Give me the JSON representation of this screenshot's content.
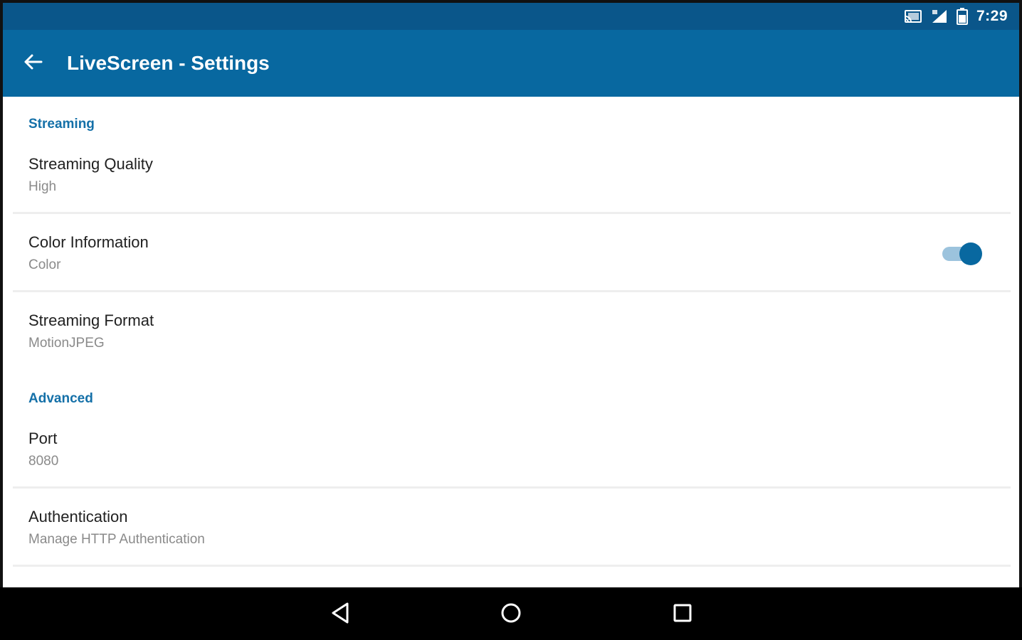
{
  "status_bar": {
    "time": "7:29",
    "icons": [
      "cast-icon",
      "signal-icon",
      "battery-icon"
    ]
  },
  "app_bar": {
    "title": "LiveScreen - Settings",
    "back_icon": "arrow-back-icon"
  },
  "settings": {
    "categories": [
      {
        "title": "Streaming",
        "items": [
          {
            "title": "Streaming Quality",
            "summary": "High"
          },
          {
            "title": "Color Information",
            "summary": "Color",
            "switch_on": true
          },
          {
            "title": "Streaming Format",
            "summary": "MotionJPEG"
          }
        ]
      },
      {
        "title": "Advanced",
        "items": [
          {
            "title": "Port",
            "summary": "8080"
          },
          {
            "title": "Authentication",
            "summary": "Manage HTTP Authentication"
          }
        ]
      }
    ]
  },
  "nav_bar": {
    "icons": [
      "back-triangle-icon",
      "home-circle-icon",
      "recents-square-icon"
    ]
  },
  "colors": {
    "status_bar": "#0a568a",
    "app_bar": "#0868a0",
    "accent": "#1470a8",
    "switch_track": "#9cc3dd"
  }
}
